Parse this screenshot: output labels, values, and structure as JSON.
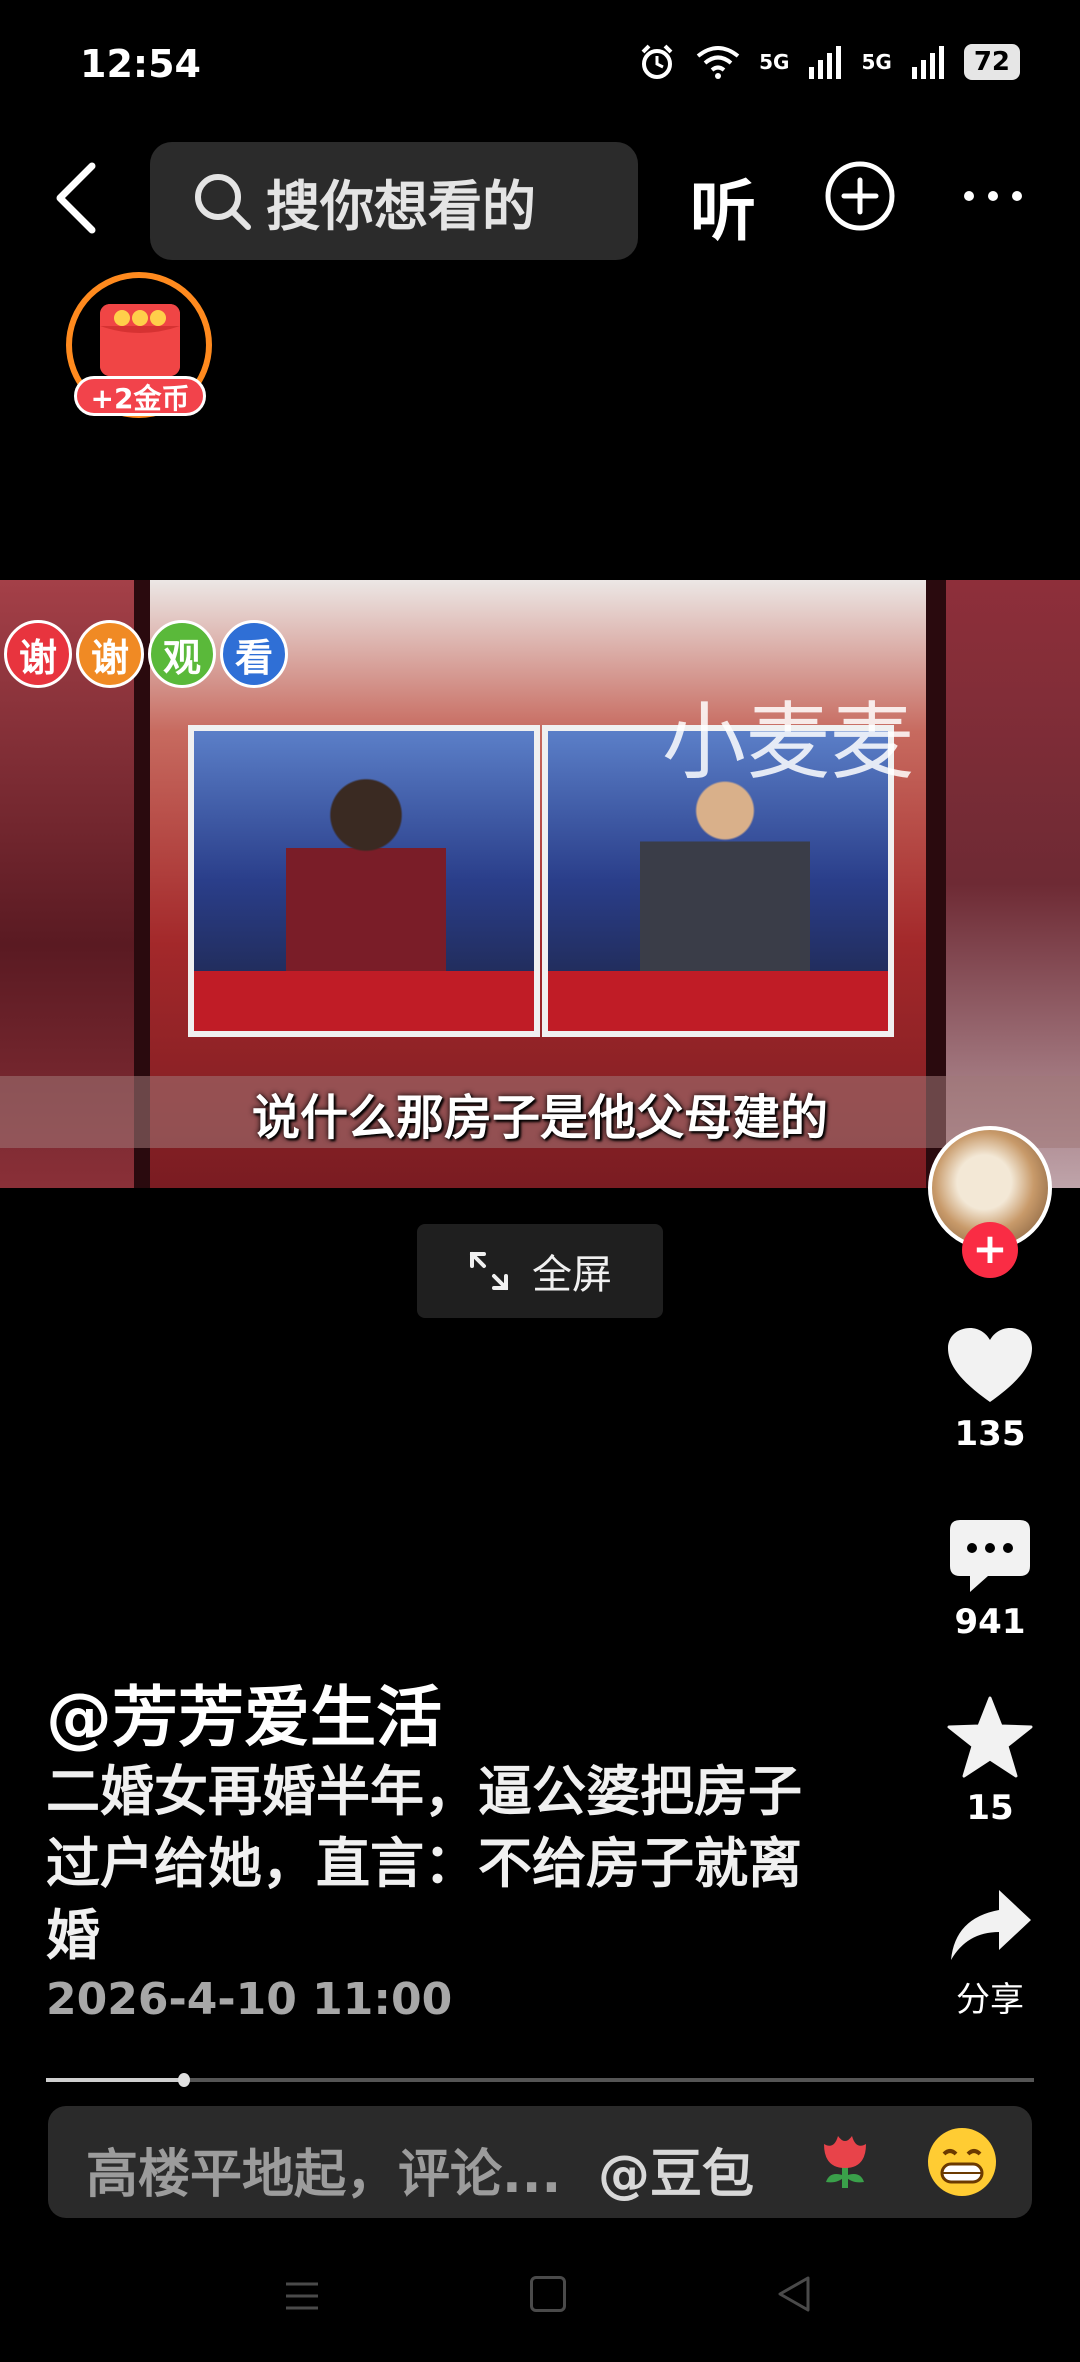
{
  "status_bar": {
    "time": "12:54",
    "network1": "5G",
    "network2": "5G",
    "battery": "72",
    "icons": [
      "alarm-icon",
      "wifi-icon",
      "signal-icon",
      "signal-icon",
      "battery-icon"
    ]
  },
  "top_bar": {
    "search_placeholder": "搜你想看的",
    "listen_label": "听",
    "icons": [
      "back-icon",
      "search-icon",
      "plus-circle-icon",
      "more-icon"
    ]
  },
  "coin_badge": {
    "label": "+2金币"
  },
  "video": {
    "thanks_chips": [
      {
        "char": "谢",
        "color": "#e8343e"
      },
      {
        "char": "谢",
        "color": "#f08a24"
      },
      {
        "char": "观",
        "color": "#5ab93a"
      },
      {
        "char": "看",
        "color": "#2f6fd6"
      }
    ],
    "watermark": "小麦麦",
    "subtitle": "说什么那房子是他父母建的"
  },
  "fullscreen": {
    "label": "全屏"
  },
  "right_rail": {
    "like_count": "135",
    "comment_count": "941",
    "favorite_count": "15",
    "share_label": "分享"
  },
  "post": {
    "author": "@芳芳爱生活",
    "description": "二婚女再婚半年，逼公婆把房子过户给她，直言：不给房子就离婚",
    "date": "2026-4-10 11:00",
    "progress_fraction": 0.14
  },
  "comment_bar": {
    "placeholder": "高楼平地起，评论...",
    "mention": "@豆包"
  },
  "colors": {
    "accent_red": "#fa2c44",
    "coin_orange": "#ff8a1e",
    "background": "#000000"
  }
}
